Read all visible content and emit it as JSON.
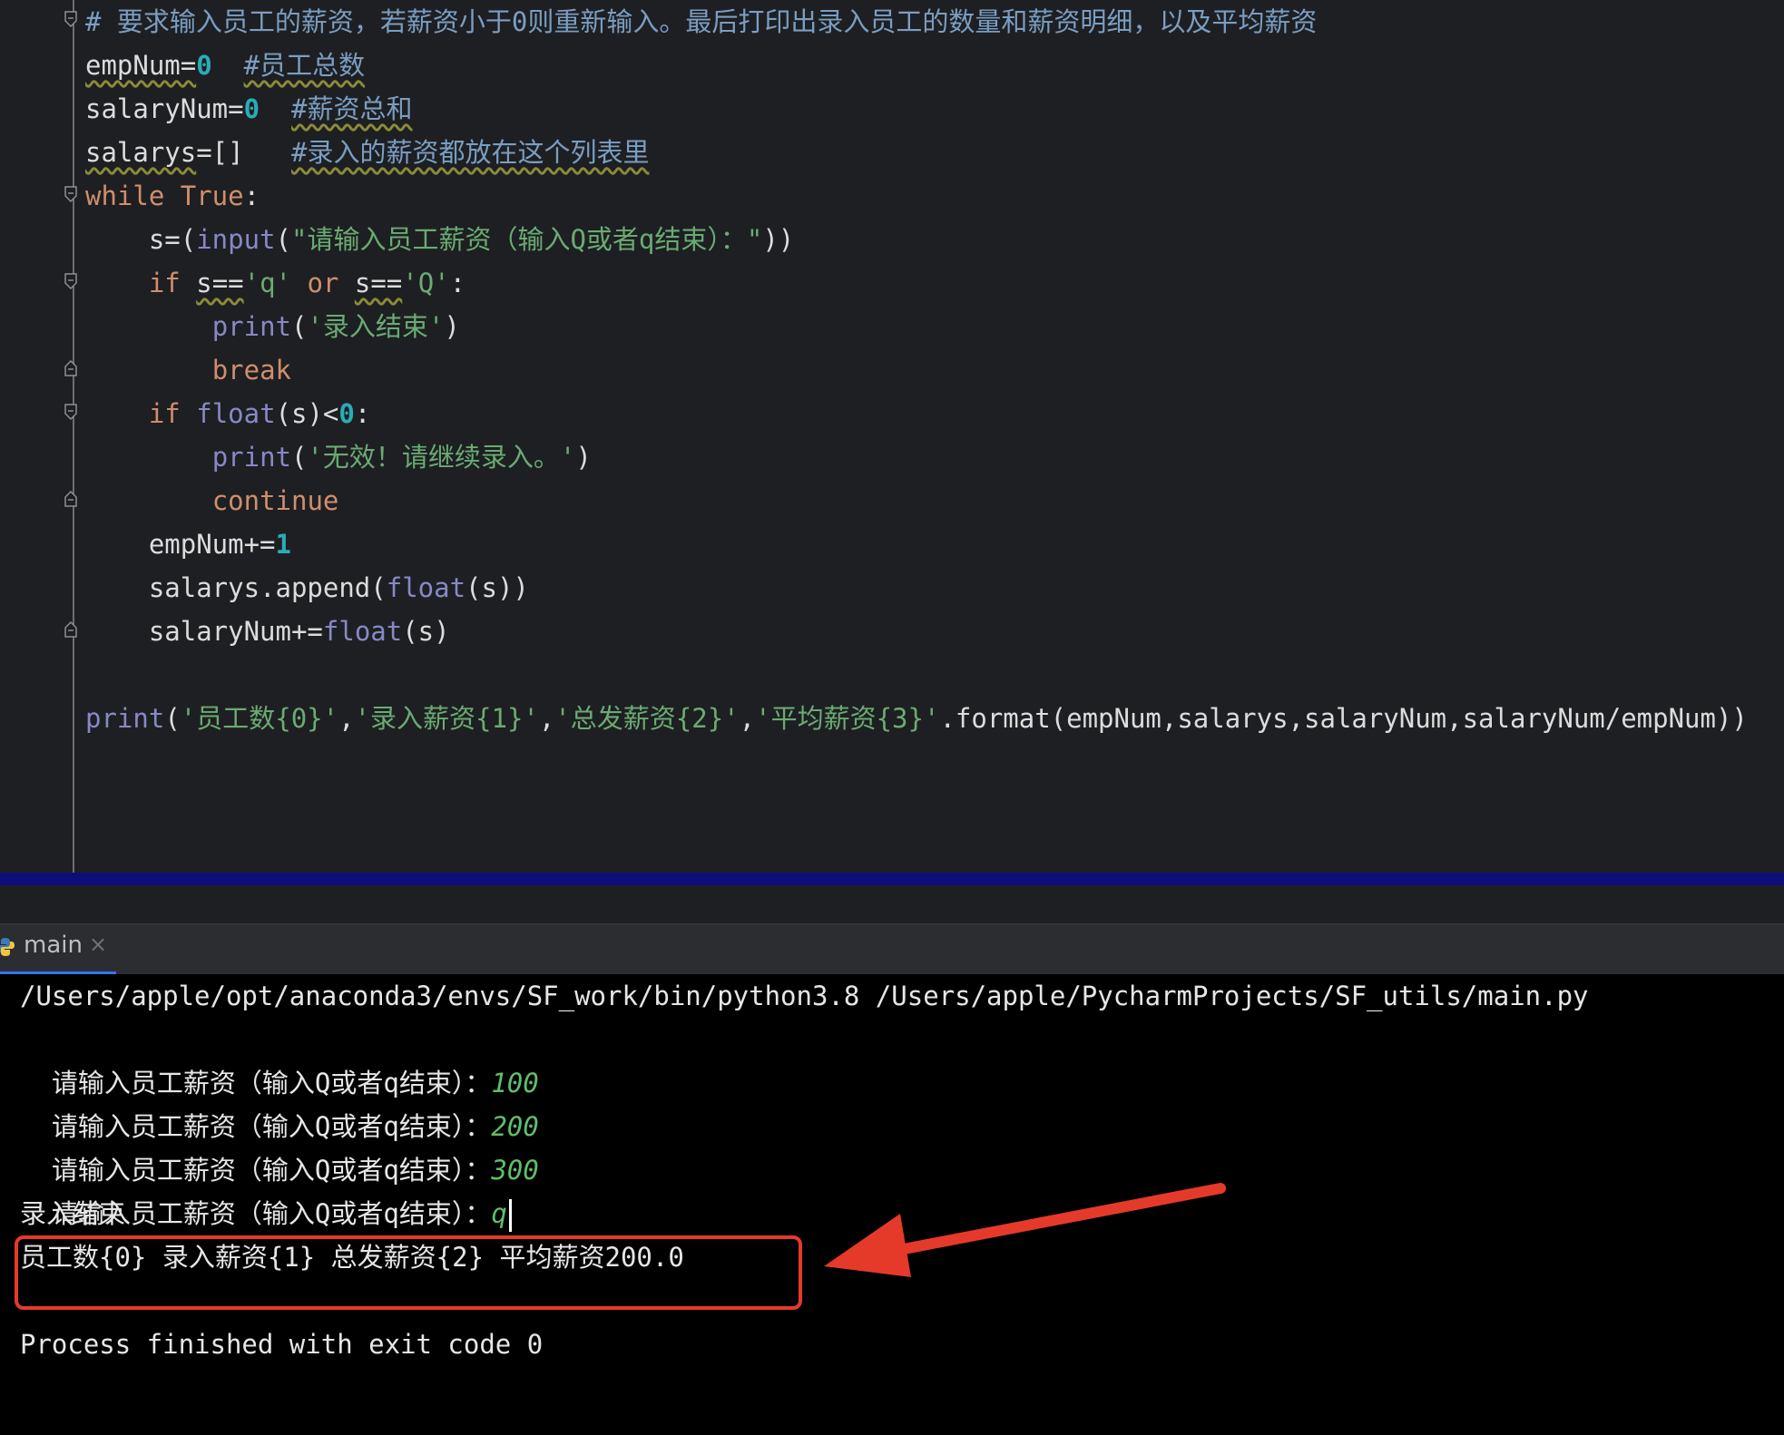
{
  "editor": {
    "lines": [
      [
        {
          "t": "# 要求输入员工的薪资，若薪资小于0则重新输入。最后打印出录入员工的数量和薪资明细，以及平均薪资",
          "c": "cmt"
        }
      ],
      [
        {
          "t": "empNum=",
          "c": "sq"
        },
        {
          "t": "0",
          "c": "num"
        },
        {
          "t": "  ",
          "c": ""
        },
        {
          "t": "#员工总数",
          "c": "cmt sq"
        }
      ],
      [
        {
          "t": "salaryNum=",
          "c": ""
        },
        {
          "t": "0",
          "c": "num"
        },
        {
          "t": "  ",
          "c": ""
        },
        {
          "t": "#薪资总和",
          "c": "cmt sq"
        }
      ],
      [
        {
          "t": "salarys",
          "c": "sq"
        },
        {
          "t": "=[]   ",
          "c": ""
        },
        {
          "t": "#录入的薪资都放在这个列表里",
          "c": "cmt sq"
        }
      ],
      [
        {
          "t": "while ",
          "c": "kw"
        },
        {
          "t": "True",
          "c": "kw"
        },
        {
          "t": ":",
          "c": ""
        }
      ],
      [
        {
          "t": "    s=(",
          "c": ""
        },
        {
          "t": "input",
          "c": "bi"
        },
        {
          "t": "(",
          "c": ""
        },
        {
          "t": "\"请输入员工薪资（输入Q或者q结束）：\"",
          "c": "str"
        },
        {
          "t": "))",
          "c": ""
        }
      ],
      [
        {
          "t": "    ",
          "c": ""
        },
        {
          "t": "if ",
          "c": "kw"
        },
        {
          "t": "s==",
          "c": "sq"
        },
        {
          "t": "'q'",
          "c": "str"
        },
        {
          "t": " or ",
          "c": "kw"
        },
        {
          "t": "s==",
          "c": "sq"
        },
        {
          "t": "'Q'",
          "c": "str"
        },
        {
          "t": ":",
          "c": ""
        }
      ],
      [
        {
          "t": "        ",
          "c": ""
        },
        {
          "t": "print",
          "c": "bi"
        },
        {
          "t": "(",
          "c": ""
        },
        {
          "t": "'录入结束'",
          "c": "str"
        },
        {
          "t": ")",
          "c": ""
        }
      ],
      [
        {
          "t": "        ",
          "c": ""
        },
        {
          "t": "break",
          "c": "kw"
        }
      ],
      [
        {
          "t": "    ",
          "c": ""
        },
        {
          "t": "if ",
          "c": "kw"
        },
        {
          "t": "float",
          "c": "bi"
        },
        {
          "t": "(s)<",
          "c": ""
        },
        {
          "t": "0",
          "c": "num"
        },
        {
          "t": ":",
          "c": ""
        }
      ],
      [
        {
          "t": "        ",
          "c": ""
        },
        {
          "t": "print",
          "c": "bi"
        },
        {
          "t": "(",
          "c": ""
        },
        {
          "t": "'无效！请继续录入。'",
          "c": "str"
        },
        {
          "t": ")",
          "c": ""
        }
      ],
      [
        {
          "t": "        ",
          "c": ""
        },
        {
          "t": "continue",
          "c": "kw"
        }
      ],
      [
        {
          "t": "    empNum+=",
          "c": ""
        },
        {
          "t": "1",
          "c": "num"
        }
      ],
      [
        {
          "t": "    salarys.append(",
          "c": ""
        },
        {
          "t": "float",
          "c": "bi"
        },
        {
          "t": "(s))",
          "c": ""
        }
      ],
      [
        {
          "t": "    salaryNum+=",
          "c": ""
        },
        {
          "t": "float",
          "c": "bi"
        },
        {
          "t": "(s)",
          "c": ""
        }
      ],
      [
        {
          "t": "",
          "c": ""
        }
      ],
      [
        {
          "t": "print",
          "c": "bi"
        },
        {
          "t": "(",
          "c": ""
        },
        {
          "t": "'员工数{0}'",
          "c": "str"
        },
        {
          "t": ",",
          "c": ""
        },
        {
          "t": "'录入薪资{1}'",
          "c": "str"
        },
        {
          "t": ",",
          "c": ""
        },
        {
          "t": "'总发薪资{2}'",
          "c": "str"
        },
        {
          "t": ",",
          "c": ""
        },
        {
          "t": "'平均薪资{3}'",
          "c": "str"
        },
        {
          "t": ".format(empNum,salarys,salaryNum,salaryNum/empNum))",
          "c": ""
        }
      ]
    ]
  },
  "run_tab": {
    "label": "main",
    "close": "×"
  },
  "console": {
    "command": "/Users/apple/opt/anaconda3/envs/SF_work/bin/python3.8 /Users/apple/PycharmProjects/SF_utils/main.py",
    "prompt": "请输入员工薪资（输入Q或者q结束）：",
    "inputs": [
      "100",
      "200",
      "300",
      "q"
    ],
    "end_message": "录入结束",
    "result": "员工数{0} 录入薪资{1} 总发薪资{2} 平均薪资200.0",
    "exit_message": "Process finished with exit code 0"
  },
  "colors": {
    "annotation": "#e53a2a",
    "tab_underline": "#3574f0",
    "divider": "#0d0f78"
  }
}
